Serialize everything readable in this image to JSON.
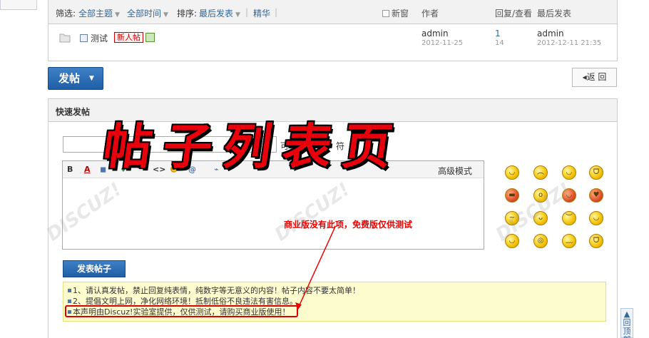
{
  "filter_bar": {
    "filter_label": "筛选:",
    "all_topics": "全部主题",
    "all_time": "全部时间",
    "sort_label": "排序:",
    "latest_post": "最后发表",
    "digest": "精华",
    "new_window": "新窗",
    "col_author": "作者",
    "col_replies": "回复/查看",
    "col_last": "最后发表"
  },
  "thread": {
    "title": "测试",
    "badge": "新人帖",
    "author": "admin",
    "author_date": "2012-11-25",
    "replies": "1",
    "views": "14",
    "last_author": "admin",
    "last_date": "2012-12-11 21:35"
  },
  "buttons": {
    "post": "发帖",
    "back": "返 回",
    "submit": "发表帖子"
  },
  "quick_post": {
    "header": "快速发帖",
    "subject_hint": "可输入",
    "subject_hint2": "符",
    "advanced": "高级模式"
  },
  "toolbar": [
    "B",
    "A",
    "◼",
    "♦",
    "\"",
    "<>",
    "☻",
    "@",
    "⌁"
  ],
  "notices": [
    "1、请认真发帖，禁止回复纯表情，纯数字等无意义的内容！帖子内容不要太简单！",
    "2、提倡文明上网，净化网络环境！抵制低俗不良违法有害信息。",
    "本声明由Discuz!实验室提供，仅供测试，请购买商业版使用！"
  ],
  "overlay": {
    "big_title": "帖子列表页",
    "callout": "商业版没有此项，免费版仅供测试"
  },
  "side": {
    "to_top": "回顶部"
  },
  "colors": {
    "accent_blue": "#1f5fa8",
    "link": "#336699",
    "alert_red": "#e00000",
    "notice_bg": "#fdfccf"
  }
}
